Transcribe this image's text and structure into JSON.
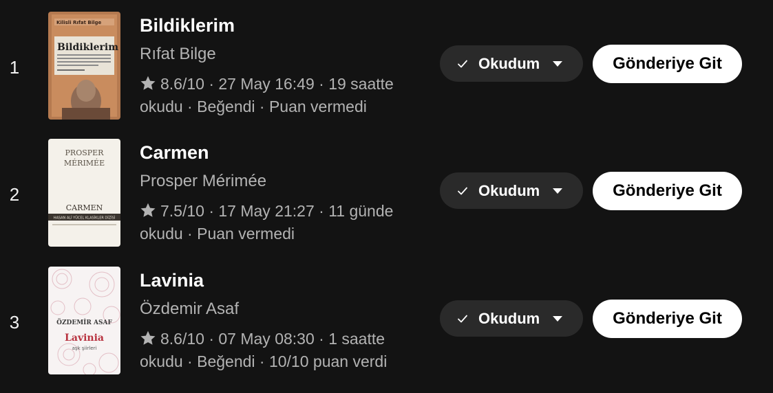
{
  "colors": {
    "background": "#131313",
    "primary_text": "#ffffff",
    "secondary_text": "#b3b3b3",
    "pill_background": "#2a2a2a",
    "cta_background": "#ffffff"
  },
  "entries": [
    {
      "rank": "1",
      "title": "Bildiklerim",
      "author": "Rıfat Bilge",
      "meta": "8.6/10 · 27 May 16:49 · 19 saatte okudu · Beğendi · Puan vermedi",
      "status_label": "Okudum",
      "goto_label": "Gönderiye Git",
      "cover": {
        "author_text": "Kilisli Rıfat Bilge",
        "title_text": "Bildiklerim"
      }
    },
    {
      "rank": "2",
      "title": "Carmen",
      "author": "Prosper Mérimée",
      "meta": "7.5/10 · 17 May 21:27 · 11 günde okudu · Puan vermedi",
      "status_label": "Okudum",
      "goto_label": "Gönderiye Git",
      "cover": {
        "author_line1": "PROSPER",
        "author_line2": "MÉRIMÉE",
        "title_text": "CARMEN",
        "series_text": "HASAN ALİ YÜCEL KLASİKLER DİZİSİ"
      }
    },
    {
      "rank": "3",
      "title": "Lavinia",
      "author": "Özdemir Asaf",
      "meta": "8.6/10 · 07 May 08:30 · 1 saatte okudu · Beğendi · 10/10 puan verdi",
      "status_label": "Okudum",
      "goto_label": "Gönderiye Git",
      "cover": {
        "author_text": "ÖZDEMİR ASAF",
        "title_text": "Lavinia",
        "subtitle_text": "aşk şiirleri"
      }
    }
  ],
  "icons": {
    "rating": "star-icon",
    "status_check": "check-icon",
    "status_menu": "caret-down-icon"
  }
}
